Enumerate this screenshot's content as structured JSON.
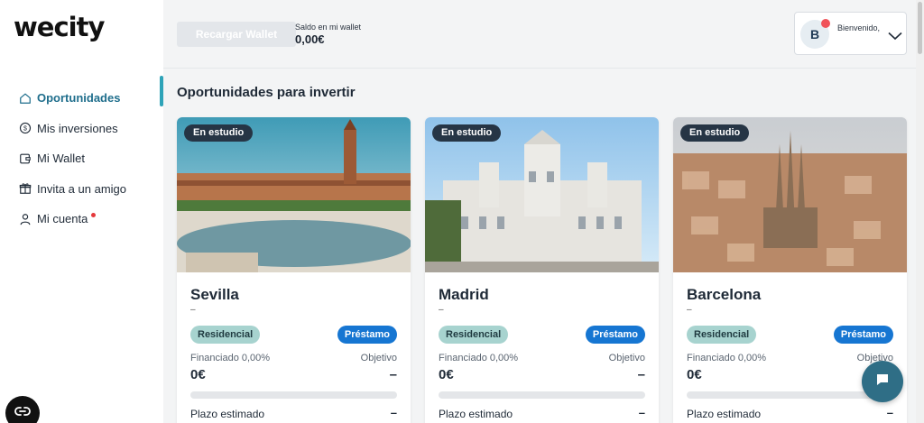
{
  "brand": {
    "logo": "wecity"
  },
  "sidebar": {
    "items": [
      {
        "label": "Oportunidades",
        "icon": "home-icon",
        "active": true
      },
      {
        "label": "Mis inversiones",
        "icon": "coin-icon",
        "active": false
      },
      {
        "label": "Mi Wallet",
        "icon": "wallet-icon",
        "active": false
      },
      {
        "label": "Invita a un amigo",
        "icon": "gift-icon",
        "active": false
      },
      {
        "label": "Mi cuenta",
        "icon": "user-icon",
        "active": false,
        "notification": true
      }
    ]
  },
  "header": {
    "recargar_label": "Recargar Wallet",
    "saldo_label": "Saldo en mi wallet",
    "saldo_value": "0,00€",
    "user_initial": "B",
    "welcome": "Bienvenido,"
  },
  "main": {
    "title": "Oportunidades para invertir",
    "cards": [
      {
        "status": "En estudio",
        "city": "Sevilla",
        "subtitle": "–",
        "tag_type": "Residencial",
        "tag_product": "Préstamo",
        "financed_label": "Financiado 0,00%",
        "objective_label": "Objetivo",
        "financed_value": "0€",
        "objective_value": "–",
        "progress": 0,
        "term_label": "Plazo estimado",
        "term_value": "–"
      },
      {
        "status": "En estudio",
        "city": "Madrid",
        "subtitle": "–",
        "tag_type": "Residencial",
        "tag_product": "Préstamo",
        "financed_label": "Financiado 0,00%",
        "objective_label": "Objetivo",
        "financed_value": "0€",
        "objective_value": "–",
        "progress": 0,
        "term_label": "Plazo estimado",
        "term_value": "–"
      },
      {
        "status": "En estudio",
        "city": "Barcelona",
        "subtitle": "–",
        "tag_type": "Residencial",
        "tag_product": "Préstamo",
        "financed_label": "Financiado 0,00%",
        "objective_label": "Objetivo",
        "financed_value": "0€",
        "objective_value": "–",
        "progress": 0,
        "term_label": "Plazo estimado",
        "term_value": "–"
      }
    ]
  },
  "colors": {
    "accent": "#2ea3b8",
    "badge_dark": "#263545",
    "tag_residencial": "#a7d3cf",
    "tag_prestamo": "#1676d2",
    "notification": "#e5383b"
  },
  "widgets": {
    "chat_icon": "chat-icon",
    "cookie_icon": "cookie-settings-icon"
  }
}
